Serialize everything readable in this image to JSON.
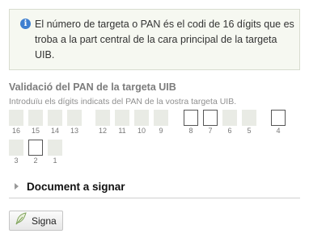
{
  "info": {
    "icon": "info-icon",
    "text": "El número de targeta o PAN és el codi de 16 dígits que es troba a la part central de la cara principal de la targeta UIB."
  },
  "pan_section": {
    "title": "Validació del PAN de la targeta UIB",
    "hint": "Introduïu els dígits indicats del PAN de la vostra targeta UIB.",
    "cells": [
      {
        "label": "16",
        "input": false
      },
      {
        "label": "15",
        "input": false
      },
      {
        "label": "14",
        "input": false
      },
      {
        "label": "13",
        "input": false
      },
      {
        "label": "12",
        "input": false
      },
      {
        "label": "11",
        "input": false
      },
      {
        "label": "10",
        "input": false
      },
      {
        "label": "9",
        "input": false
      },
      {
        "label": "8",
        "input": true
      },
      {
        "label": "7",
        "input": true
      },
      {
        "label": "6",
        "input": false
      },
      {
        "label": "5",
        "input": false
      },
      {
        "label": "4",
        "input": true
      },
      {
        "label": "3",
        "input": false
      },
      {
        "label": "2",
        "input": true
      },
      {
        "label": "1",
        "input": false
      }
    ]
  },
  "document": {
    "label": "Document a signar",
    "icon": "triangle-right-icon"
  },
  "sign_button": {
    "label": "Signa",
    "icon": "feather-pen-icon"
  }
}
